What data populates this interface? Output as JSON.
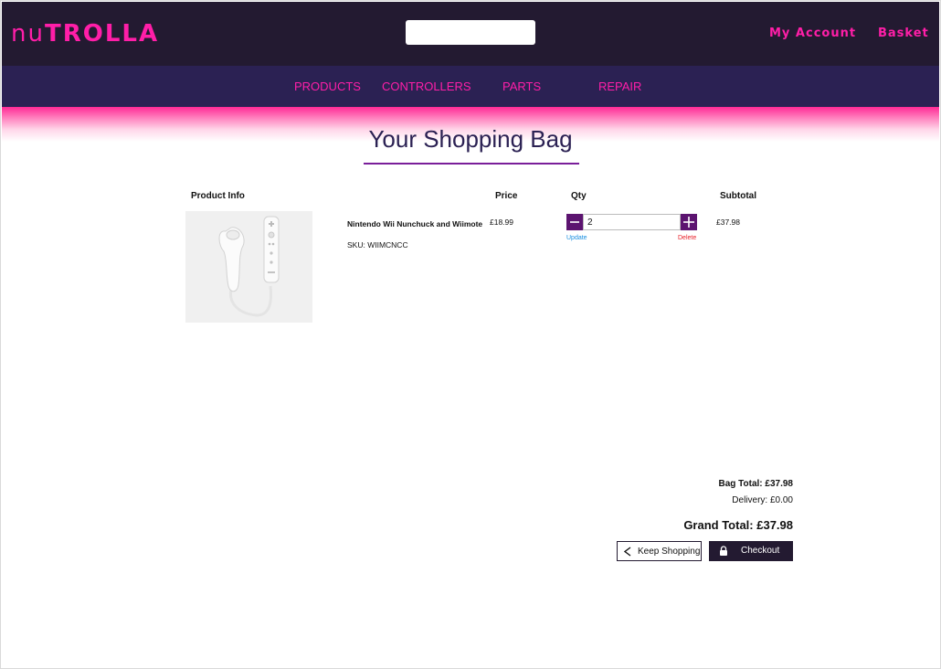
{
  "brand": {
    "logo_light": "nu",
    "logo_bold": "TROLLA",
    "color": "#ff1ea8"
  },
  "header": {
    "search_value": "",
    "my_account": "My Account",
    "basket": "Basket"
  },
  "nav": {
    "items": [
      "PRODUCTS",
      "CONTROLLERS",
      "PARTS",
      "REPAIR"
    ]
  },
  "page": {
    "title": "Your Shopping Bag"
  },
  "table": {
    "headers": {
      "product_info": "Product Info",
      "price": "Price",
      "qty": "Qty",
      "subtotal": "Subtotal"
    },
    "items": [
      {
        "name": "Nintendo Wii Nunchuck and Wiimote",
        "sku": "SKU: WIIMCNCC",
        "price": "£18.99",
        "qty": "2",
        "subtotal": "£37.98",
        "update_label": "Update",
        "delete_label": "Delete"
      }
    ]
  },
  "summary": {
    "bag_total": "Bag Total: £37.98",
    "delivery": "Delivery: £0.00",
    "grand_total": "Grand Total: £37.98"
  },
  "actions": {
    "keep_shopping": "Keep Shopping",
    "checkout": "Checkout"
  },
  "colors": {
    "header_bg": "#231a31",
    "nav_bg": "#2b2153",
    "accent": "#ff1ea8",
    "qty_btn": "#5c1470",
    "update": "#1a8fe0",
    "delete": "#e8202a"
  },
  "icons": [
    "minus-icon",
    "plus-icon",
    "chevron-left-icon",
    "lock-icon"
  ]
}
